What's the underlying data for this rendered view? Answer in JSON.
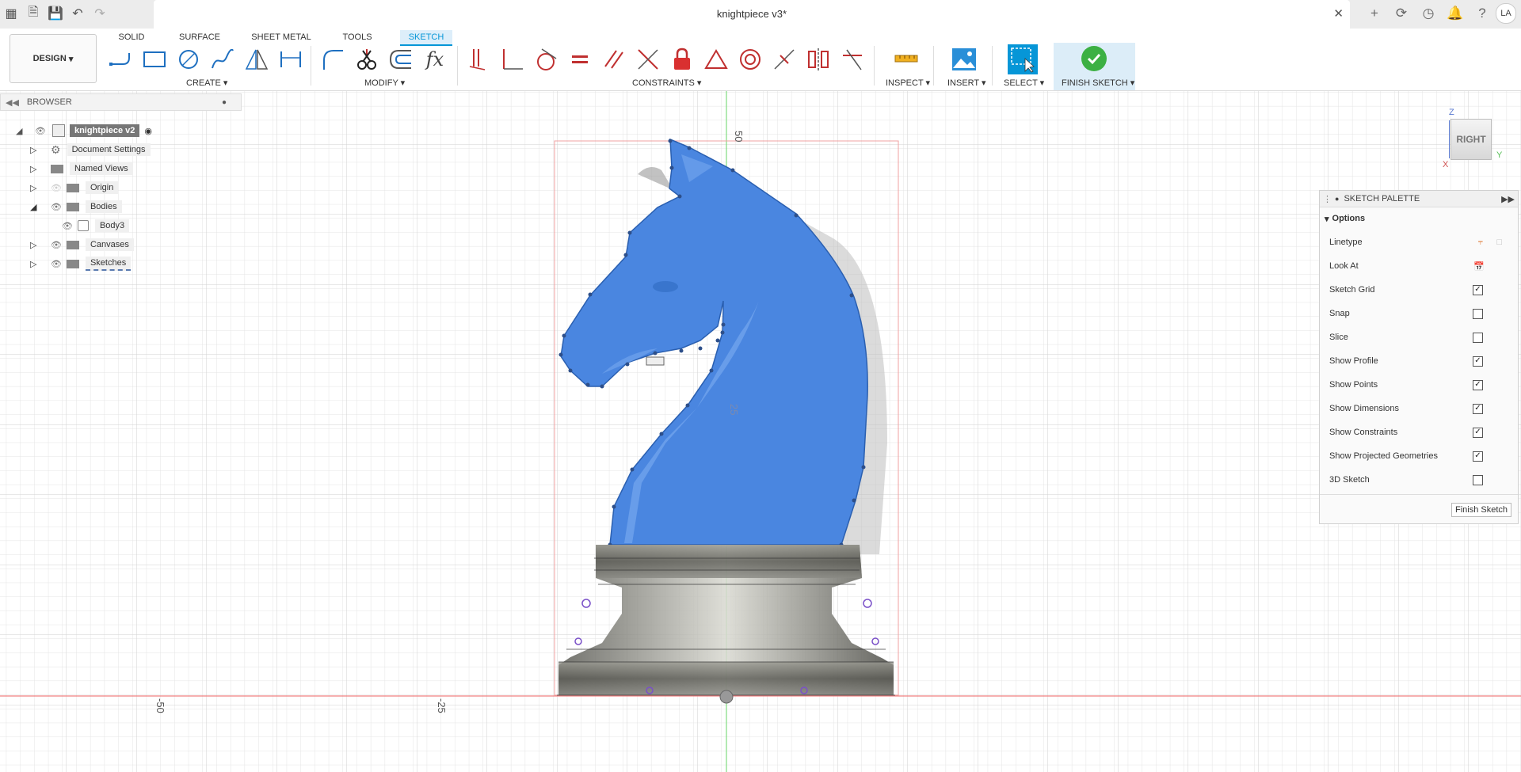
{
  "titlebar": {
    "doc_title": "knightpiece v3*",
    "user_initials": "LA"
  },
  "ribbon": {
    "workspace_label": "DESIGN",
    "tabs": [
      "SOLID",
      "SURFACE",
      "SHEET METAL",
      "TOOLS",
      "SKETCH"
    ],
    "active_tab": "SKETCH",
    "groups": {
      "create": "CREATE",
      "modify": "MODIFY",
      "constraints": "CONSTRAINTS",
      "inspect": "INSPECT",
      "insert": "INSERT",
      "select": "SELECT",
      "finish": "FINISH SKETCH"
    },
    "accent_color": "#0696d7",
    "finish_color": "#3cb043"
  },
  "browser": {
    "title": "BROWSER",
    "root": "knightpiece v2",
    "items": [
      {
        "label": "Document Settings",
        "icon": "gear-icon"
      },
      {
        "label": "Named Views",
        "icon": "folder-icon"
      },
      {
        "label": "Origin",
        "icon": "folder-icon"
      },
      {
        "label": "Bodies",
        "icon": "folder-icon"
      },
      {
        "label": "Body3",
        "icon": "body-icon"
      },
      {
        "label": "Canvases",
        "icon": "folder-icon"
      },
      {
        "label": "Sketches",
        "icon": "folder-icon"
      }
    ]
  },
  "palette": {
    "title": "SKETCH PALETTE",
    "section": "Options",
    "options": [
      {
        "label": "Linetype",
        "type": "icons"
      },
      {
        "label": "Look At",
        "type": "icon"
      },
      {
        "label": "Sketch Grid",
        "checked": true
      },
      {
        "label": "Snap",
        "checked": false
      },
      {
        "label": "Slice",
        "checked": false
      },
      {
        "label": "Show Profile",
        "checked": true
      },
      {
        "label": "Show Points",
        "checked": true
      },
      {
        "label": "Show Dimensions",
        "checked": true
      },
      {
        "label": "Show Constraints",
        "checked": true
      },
      {
        "label": "Show Projected Geometries",
        "checked": true
      },
      {
        "label": "3D Sketch",
        "checked": false
      }
    ],
    "finish_button": "Finish Sketch"
  },
  "viewport": {
    "axis_labels": [
      "50",
      "25",
      "-50",
      "-25"
    ],
    "profile_color": "#4a86e0",
    "bounding_color": "#e87070"
  },
  "viewcube": {
    "face": "RIGHT",
    "axis_z": "Z",
    "axis_y": "Y",
    "axis_x": "X"
  }
}
